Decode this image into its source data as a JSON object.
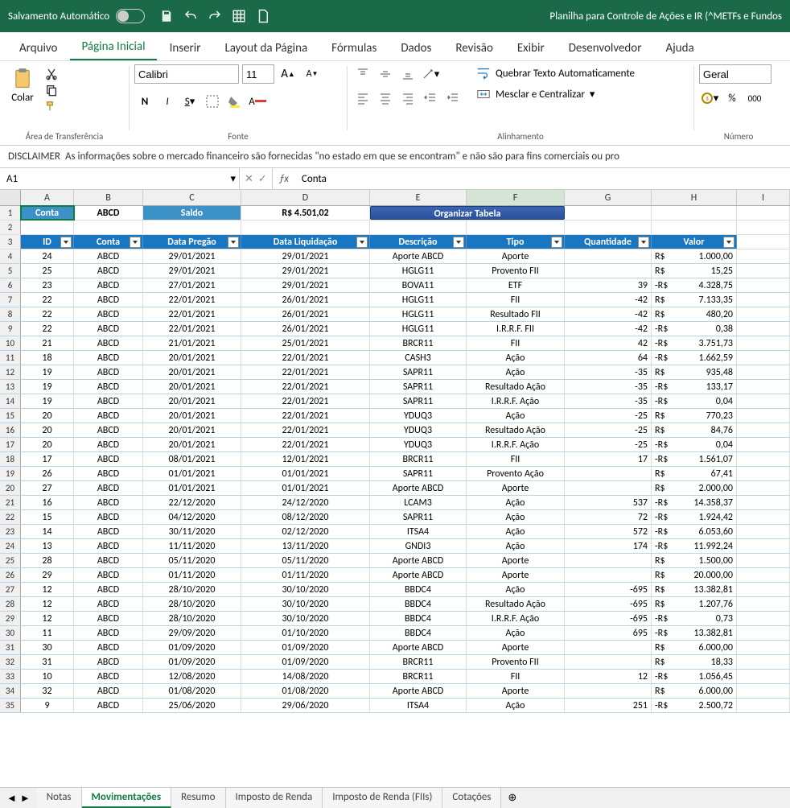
{
  "titlebar": {
    "autosave": "Salvamento Automático",
    "doc": "Planilha para Controle de Ações e IR (^METFs e Fundos"
  },
  "ribbon": {
    "tabs": [
      "Arquivo",
      "Página Inicial",
      "Inserir",
      "Layout da Página",
      "Fórmulas",
      "Dados",
      "Revisão",
      "Exibir",
      "Desenvolvedor",
      "Ajuda"
    ],
    "active": 1,
    "paste": "Colar",
    "font_name": "Calibri",
    "font_size": "11",
    "wrap": "Quebrar Texto Automaticamente",
    "merge": "Mesclar e Centralizar",
    "num_format": "Geral",
    "groups": {
      "clip": "Área de Transferência",
      "font": "Fonte",
      "align": "Alinhamento",
      "num": "Número"
    }
  },
  "disclaimer": {
    "label": "DISCLAIMER",
    "text": "As informações sobre o mercado financeiro são fornecidas \"no estado em que se encontram\" e não são para fins comerciais ou pro"
  },
  "namebox": "A1",
  "formula": "Conta",
  "cols": [
    "A",
    "B",
    "C",
    "D",
    "E",
    "F",
    "G",
    "H",
    "I"
  ],
  "row1": {
    "conta_hdr": "Conta",
    "conta_val": "ABCD",
    "saldo_hdr": "Saldo",
    "saldo_val": "R$ 4.501,02",
    "org": "Organizar Tabela"
  },
  "thead": [
    "ID",
    "Conta",
    "Data Pregão",
    "Data Liquidação",
    "Descrição",
    "Tipo",
    "Quantidade",
    "Valor"
  ],
  "rows": [
    {
      "n": 4,
      "id": "24",
      "c": "ABCD",
      "dp": "29/01/2021",
      "dl": "29/01/2021",
      "d": "Aporte ABCD",
      "t": "Aporte",
      "q": "",
      "vs": "R$",
      "v": "1.000,00"
    },
    {
      "n": 5,
      "id": "25",
      "c": "ABCD",
      "dp": "29/01/2021",
      "dl": "29/01/2021",
      "d": "HGLG11",
      "t": "Provento FII",
      "q": "",
      "vs": "R$",
      "v": "15,25"
    },
    {
      "n": 6,
      "id": "23",
      "c": "ABCD",
      "dp": "27/01/2021",
      "dl": "29/01/2021",
      "d": "BOVA11",
      "t": "ETF",
      "q": "39",
      "vs": "-R$",
      "v": "4.328,75"
    },
    {
      "n": 7,
      "id": "22",
      "c": "ABCD",
      "dp": "22/01/2021",
      "dl": "26/01/2021",
      "d": "HGLG11",
      "t": "FII",
      "q": "-42",
      "vs": "R$",
      "v": "7.133,35"
    },
    {
      "n": 8,
      "id": "22",
      "c": "ABCD",
      "dp": "22/01/2021",
      "dl": "26/01/2021",
      "d": "HGLG11",
      "t": "Resultado FII",
      "q": "-42",
      "vs": "R$",
      "v": "480,20"
    },
    {
      "n": 9,
      "id": "22",
      "c": "ABCD",
      "dp": "22/01/2021",
      "dl": "26/01/2021",
      "d": "HGLG11",
      "t": "I.R.R.F. FII",
      "q": "-42",
      "vs": "-R$",
      "v": "0,38"
    },
    {
      "n": 10,
      "id": "21",
      "c": "ABCD",
      "dp": "21/01/2021",
      "dl": "25/01/2021",
      "d": "BRCR11",
      "t": "FII",
      "q": "42",
      "vs": "-R$",
      "v": "3.751,73"
    },
    {
      "n": 11,
      "id": "18",
      "c": "ABCD",
      "dp": "20/01/2021",
      "dl": "22/01/2021",
      "d": "CASH3",
      "t": "Ação",
      "q": "64",
      "vs": "-R$",
      "v": "1.662,59"
    },
    {
      "n": 12,
      "id": "19",
      "c": "ABCD",
      "dp": "20/01/2021",
      "dl": "22/01/2021",
      "d": "SAPR11",
      "t": "Ação",
      "q": "-35",
      "vs": "R$",
      "v": "935,48"
    },
    {
      "n": 13,
      "id": "19",
      "c": "ABCD",
      "dp": "20/01/2021",
      "dl": "22/01/2021",
      "d": "SAPR11",
      "t": "Resultado Ação",
      "q": "-35",
      "vs": "-R$",
      "v": "133,17"
    },
    {
      "n": 14,
      "id": "19",
      "c": "ABCD",
      "dp": "20/01/2021",
      "dl": "22/01/2021",
      "d": "SAPR11",
      "t": "I.R.R.F. Ação",
      "q": "-35",
      "vs": "-R$",
      "v": "0,04"
    },
    {
      "n": 15,
      "id": "20",
      "c": "ABCD",
      "dp": "20/01/2021",
      "dl": "22/01/2021",
      "d": "YDUQ3",
      "t": "Ação",
      "q": "-25",
      "vs": "R$",
      "v": "770,23"
    },
    {
      "n": 16,
      "id": "20",
      "c": "ABCD",
      "dp": "20/01/2021",
      "dl": "22/01/2021",
      "d": "YDUQ3",
      "t": "Resultado Ação",
      "q": "-25",
      "vs": "R$",
      "v": "84,76"
    },
    {
      "n": 17,
      "id": "20",
      "c": "ABCD",
      "dp": "20/01/2021",
      "dl": "22/01/2021",
      "d": "YDUQ3",
      "t": "I.R.R.F. Ação",
      "q": "-25",
      "vs": "-R$",
      "v": "0,04"
    },
    {
      "n": 18,
      "id": "17",
      "c": "ABCD",
      "dp": "08/01/2021",
      "dl": "12/01/2021",
      "d": "BRCR11",
      "t": "FII",
      "q": "17",
      "vs": "-R$",
      "v": "1.561,07"
    },
    {
      "n": 19,
      "id": "26",
      "c": "ABCD",
      "dp": "01/01/2021",
      "dl": "01/01/2021",
      "d": "SAPR11",
      "t": "Provento Ação",
      "q": "",
      "vs": "R$",
      "v": "67,41"
    },
    {
      "n": 20,
      "id": "27",
      "c": "ABCD",
      "dp": "01/01/2021",
      "dl": "01/01/2021",
      "d": "Aporte ABCD",
      "t": "Aporte",
      "q": "",
      "vs": "R$",
      "v": "2.000,00"
    },
    {
      "n": 21,
      "id": "16",
      "c": "ABCD",
      "dp": "22/12/2020",
      "dl": "24/12/2020",
      "d": "LCAM3",
      "t": "Ação",
      "q": "537",
      "vs": "-R$",
      "v": "14.358,37"
    },
    {
      "n": 22,
      "id": "15",
      "c": "ABCD",
      "dp": "04/12/2020",
      "dl": "08/12/2020",
      "d": "SAPR11",
      "t": "Ação",
      "q": "72",
      "vs": "-R$",
      "v": "1.924,42"
    },
    {
      "n": 23,
      "id": "14",
      "c": "ABCD",
      "dp": "30/11/2020",
      "dl": "02/12/2020",
      "d": "ITSA4",
      "t": "Ação",
      "q": "572",
      "vs": "-R$",
      "v": "6.053,60"
    },
    {
      "n": 24,
      "id": "13",
      "c": "ABCD",
      "dp": "11/11/2020",
      "dl": "13/11/2020",
      "d": "GNDI3",
      "t": "Ação",
      "q": "174",
      "vs": "-R$",
      "v": "11.992,24"
    },
    {
      "n": 25,
      "id": "28",
      "c": "ABCD",
      "dp": "05/11/2020",
      "dl": "05/11/2020",
      "d": "Aporte ABCD",
      "t": "Aporte",
      "q": "",
      "vs": "R$",
      "v": "1.500,00"
    },
    {
      "n": 26,
      "id": "29",
      "c": "ABCD",
      "dp": "01/11/2020",
      "dl": "01/11/2020",
      "d": "Aporte ABCD",
      "t": "Aporte",
      "q": "",
      "vs": "R$",
      "v": "20.000,00"
    },
    {
      "n": 27,
      "id": "12",
      "c": "ABCD",
      "dp": "28/10/2020",
      "dl": "30/10/2020",
      "d": "BBDC4",
      "t": "Ação",
      "q": "-695",
      "vs": "R$",
      "v": "13.382,81"
    },
    {
      "n": 28,
      "id": "12",
      "c": "ABCD",
      "dp": "28/10/2020",
      "dl": "30/10/2020",
      "d": "BBDC4",
      "t": "Resultado Ação",
      "q": "-695",
      "vs": "R$",
      "v": "1.207,76"
    },
    {
      "n": 29,
      "id": "12",
      "c": "ABCD",
      "dp": "28/10/2020",
      "dl": "30/10/2020",
      "d": "BBDC4",
      "t": "I.R.R.F. Ação",
      "q": "-695",
      "vs": "-R$",
      "v": "0,73"
    },
    {
      "n": 30,
      "id": "11",
      "c": "ABCD",
      "dp": "29/09/2020",
      "dl": "01/10/2020",
      "d": "BBDC4",
      "t": "Ação",
      "q": "695",
      "vs": "-R$",
      "v": "13.382,81"
    },
    {
      "n": 31,
      "id": "30",
      "c": "ABCD",
      "dp": "01/09/2020",
      "dl": "01/09/2020",
      "d": "Aporte ABCD",
      "t": "Aporte",
      "q": "",
      "vs": "R$",
      "v": "6.000,00"
    },
    {
      "n": 32,
      "id": "31",
      "c": "ABCD",
      "dp": "01/09/2020",
      "dl": "01/09/2020",
      "d": "BRCR11",
      "t": "Provento FII",
      "q": "",
      "vs": "R$",
      "v": "18,33"
    },
    {
      "n": 33,
      "id": "10",
      "c": "ABCD",
      "dp": "12/08/2020",
      "dl": "14/08/2020",
      "d": "BRCR11",
      "t": "FII",
      "q": "12",
      "vs": "-R$",
      "v": "1.056,45"
    },
    {
      "n": 34,
      "id": "32",
      "c": "ABCD",
      "dp": "01/08/2020",
      "dl": "01/08/2020",
      "d": "Aporte ABCD",
      "t": "Aporte",
      "q": "",
      "vs": "R$",
      "v": "6.000,00"
    },
    {
      "n": 35,
      "id": "9",
      "c": "ABCD",
      "dp": "25/06/2020",
      "dl": "29/06/2020",
      "d": "ITSA4",
      "t": "Ação",
      "q": "251",
      "vs": "-R$",
      "v": "2.500,72"
    }
  ],
  "sheets": {
    "tabs": [
      "Notas",
      "Movimentações",
      "Resumo",
      "Imposto de Renda",
      "Imposto de Renda (FIIs)",
      "Cotações"
    ],
    "active": 1
  }
}
